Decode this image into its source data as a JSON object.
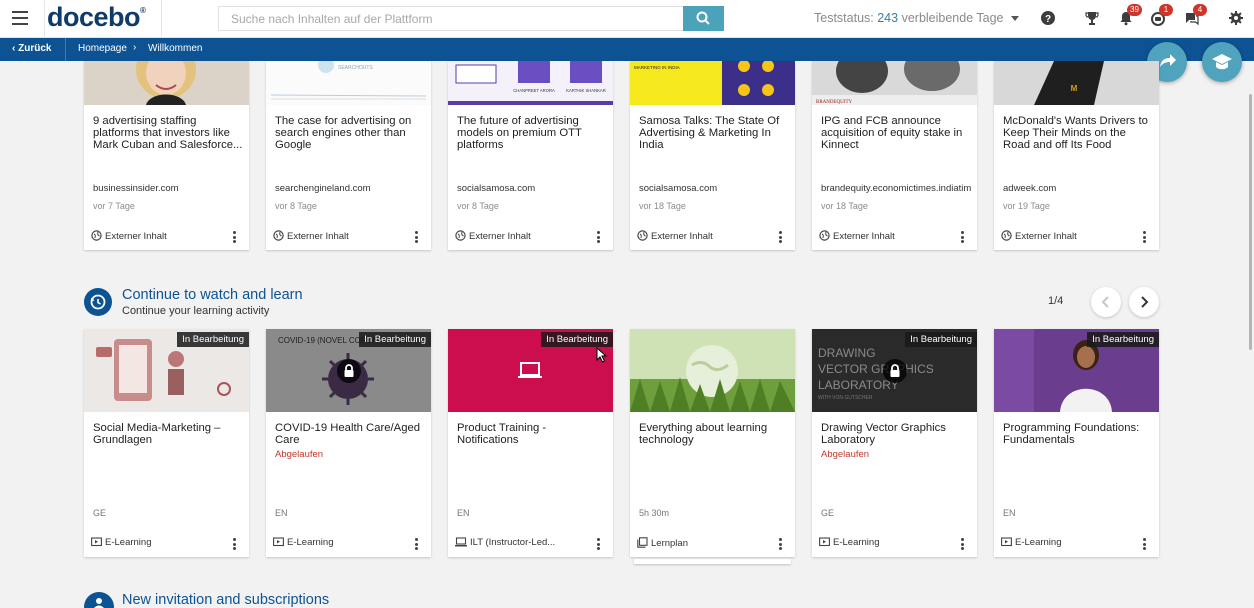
{
  "header": {
    "logo": "docebo",
    "search_placeholder": "Suche nach Inhalten auf der Plattform",
    "trial_prefix": "Teststatus:",
    "trial_days": "243",
    "trial_suffix": "verbleibende Tage",
    "notifications_count": "39",
    "activity_count": "1",
    "messages_count": "4"
  },
  "breadcrumb": {
    "back": "Zurück",
    "items": [
      "Homepage",
      "Willkommen"
    ]
  },
  "feed_cards": [
    {
      "title": "9 advertising staffing platforms that investors like Mark Cuban and Salesforce...",
      "source": "businessinsider.com",
      "age": "vor 7 Tage",
      "type": "Externer Inhalt"
    },
    {
      "title": "The case for advertising on search engines other than Google",
      "source": "searchengineland.com",
      "age": "vor 8 Tage",
      "type": "Externer Inhalt",
      "thumb_text": "SEARCHOUTS"
    },
    {
      "title": "The future of advertising models on premium OTT platforms",
      "source": "socialsamosa.com",
      "age": "vor 8 Tage",
      "type": "Externer Inhalt",
      "thumb_texts": [
        "CHANPREET ARORA",
        "KARTHIK SHANKAR"
      ]
    },
    {
      "title": "Samosa Talks: The State Of Advertising & Marketing In India",
      "source": "socialsamosa.com",
      "age": "vor 18 Tage",
      "type": "Externer Inhalt",
      "thumb_text": "MARKETING IN INDIA"
    },
    {
      "title": "IPG and FCB announce acquisition of equity stake in Kinnect",
      "source": "brandequity.economictimes.indiatimes.com",
      "age": "vor 18 Tage",
      "type": "Externer Inhalt",
      "thumb_text": "BRANDEQUITY"
    },
    {
      "title": "McDonald's Wants Drivers to Keep Their Minds on the Road and off Its Food",
      "source": "adweek.com",
      "age": "vor 19 Tage",
      "type": "Externer Inhalt"
    }
  ],
  "section": {
    "title": "Continue to watch and learn",
    "subtitle": "Continue your learning activity",
    "pager": "1/4"
  },
  "course_cards": [
    {
      "title": "Social Media-Marketing – Grundlagen",
      "status": "In Bearbeitung",
      "lang": "GE",
      "type": "E-Learning",
      "thumb_color": "#e9e4e1"
    },
    {
      "title": "COVID-19 Health Care/Aged Care",
      "status": "In Bearbeitung",
      "expired": "Abgelaufen",
      "lang": "EN",
      "type": "E-Learning",
      "thumb_color": "#7a7a7a",
      "thumb_text": "COVID-19 (NOVEL CORONAVIRUS)"
    },
    {
      "title": "Product Training - Notifications",
      "status": "In Bearbeitung",
      "lang": "EN",
      "type": "ILT (Instructor-Led...",
      "thumb_color": "#cc0e4e"
    },
    {
      "title": "Everything about learning technology",
      "duration": "5h 30m",
      "type": "Lernplan",
      "thumb_color": "#7aa84b"
    },
    {
      "title": "Drawing Vector Graphics Laboratory",
      "status": "In Bearbeitung",
      "expired": "Abgelaufen",
      "lang": "GE",
      "type": "E-Learning",
      "thumb_color": "#2b2b2b",
      "thumb_texts": [
        "DRAWING",
        "VECTOR GRAPHICS",
        "LABORATORY",
        "WITH VON GUTSCHER"
      ]
    },
    {
      "title": "Programming Foundations: Fundamentals",
      "status": "In Bearbeitung",
      "lang": "EN",
      "type": "E-Learning",
      "thumb_color": "#6a3d8f"
    }
  ],
  "section2": {
    "title": "New invitation and subscriptions"
  },
  "colors": {
    "brand": "#0d5394",
    "accent": "#4aa3b8",
    "badge": "#d0352a",
    "expired": "#c0392b"
  }
}
